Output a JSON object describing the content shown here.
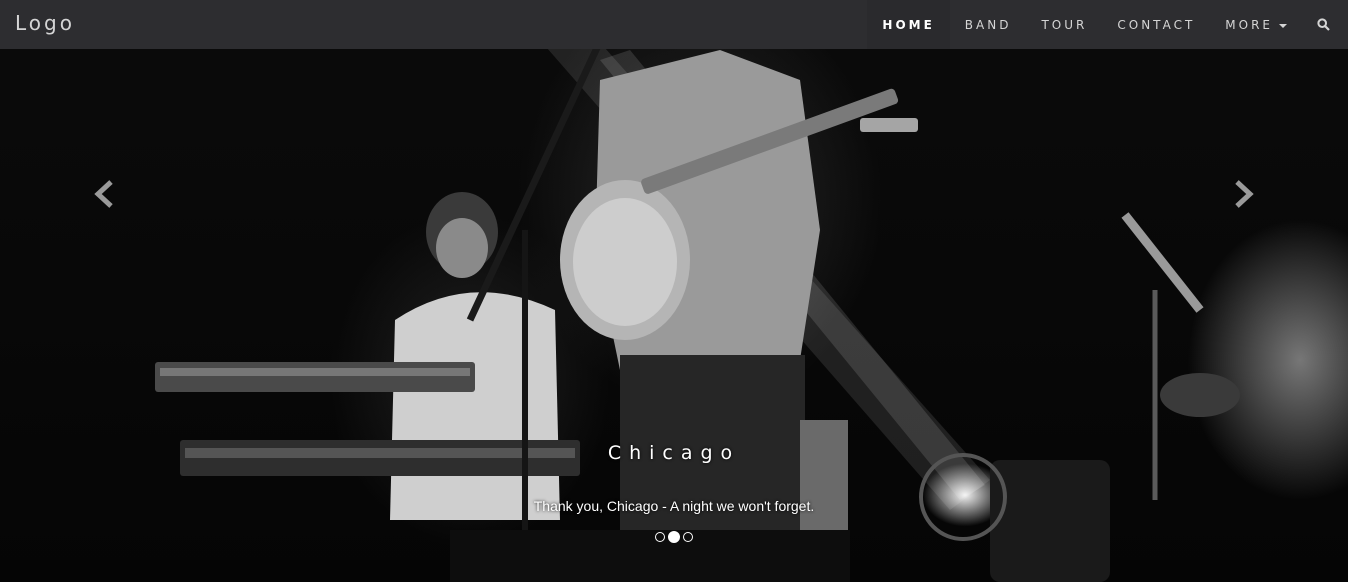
{
  "navbar": {
    "brand": "Logo",
    "items": [
      {
        "label": "HOME",
        "active": true
      },
      {
        "label": "BAND",
        "active": false
      },
      {
        "label": "TOUR",
        "active": false
      },
      {
        "label": "CONTACT",
        "active": false
      },
      {
        "label": "MORE",
        "active": false,
        "has_dropdown": true
      }
    ],
    "search_icon": "search-icon",
    "caret_icon": "caret-down-icon"
  },
  "carousel": {
    "caption_title": "Chicago",
    "caption_text": "Thank you, Chicago - A night we won't forget.",
    "prev_icon": "chevron-left-icon",
    "next_icon": "chevron-right-icon",
    "slide_count": 3,
    "active_index": 1
  },
  "colors": {
    "navbar_bg": "#2d2d30",
    "nav_text": "#d5d5d5",
    "active_text": "#ffffff"
  }
}
